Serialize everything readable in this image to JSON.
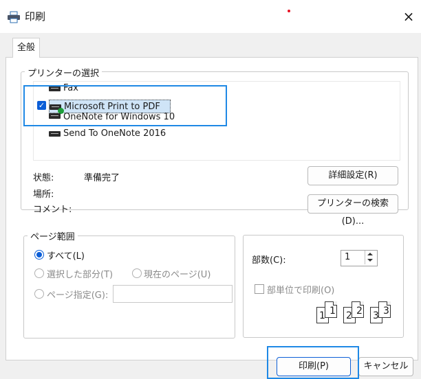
{
  "window": {
    "title": "印刷",
    "close_glyph": "×"
  },
  "tabs": [
    {
      "label": "全般",
      "selected": true
    }
  ],
  "printer_select": {
    "legend": "プリンターの選択",
    "printers": [
      {
        "name": "Fax",
        "icon": "printer-icon"
      },
      {
        "name": "Microsoft Print to PDF",
        "icon": "printer-icon",
        "selected": true,
        "default": true
      },
      {
        "name": "OneNote for Windows 10",
        "icon": "printer-icon"
      },
      {
        "name": "Send To OneNote 2016",
        "icon": "printer-icon"
      }
    ],
    "status_label": "状態:",
    "status_value": "準備完了",
    "location_label": "場所:",
    "comment_label": "コメント:",
    "details_button": "詳細設定(R)",
    "find_button": "プリンターの検索(D)..."
  },
  "page_range": {
    "legend": "ページ範囲",
    "all": "すべて(L)",
    "selection": "選択した部分(T)",
    "current_page": "現在のページ(U)",
    "pages": "ページ指定(G):",
    "pages_value": ""
  },
  "copies": {
    "label": "部数(C):",
    "value": "1",
    "collate_label": "部単位で印刷(O)",
    "collate_checked": false,
    "collate_pages": [
      "1",
      "1",
      "2",
      "2",
      "3",
      "3"
    ]
  },
  "buttons": {
    "print": "印刷(P)",
    "cancel": "キャンセル"
  },
  "colors": {
    "accent": "#1e88e5",
    "selection": "#cfe4f7",
    "dialog_bg": "#f0f0f0"
  }
}
